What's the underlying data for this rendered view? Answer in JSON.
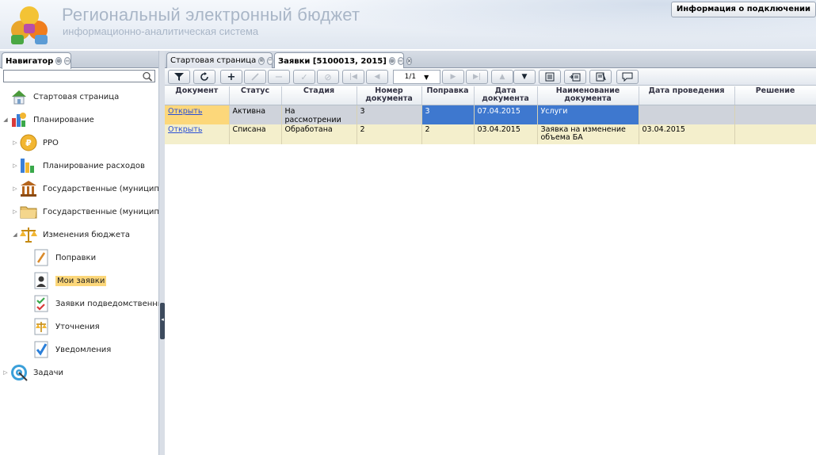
{
  "header": {
    "title": "Региональный электронный бюджет",
    "subtitle": "информационно-аналитическая система",
    "info_button": "Информация о подключении"
  },
  "navigator": {
    "tab_label": "Навигатор",
    "search_placeholder": "",
    "items": [
      {
        "label": "Стартовая страница",
        "icon": "home-icon",
        "level": 0
      },
      {
        "label": "Планирование",
        "icon": "planning-icon",
        "level": 0,
        "expanded": true
      },
      {
        "label": "РРО",
        "icon": "coin-icon",
        "level": 1
      },
      {
        "label": "Планирование расходов",
        "icon": "bar-chart-icon",
        "level": 1
      },
      {
        "label": "Государственные (муниципаль",
        "icon": "institution-icon",
        "level": 1
      },
      {
        "label": "Государственные (муниципаль",
        "icon": "folder-icon",
        "level": 1
      },
      {
        "label": "Изменения бюджета",
        "icon": "scales-icon",
        "level": 1,
        "expanded": true
      },
      {
        "label": "Поправки",
        "icon": "pencil-document-icon",
        "level": 2
      },
      {
        "label": "Мои заявки",
        "icon": "user-document-icon",
        "level": 2,
        "selected": true
      },
      {
        "label": "Заявки подведомственных",
        "icon": "check-list-icon",
        "level": 2
      },
      {
        "label": "Уточнения",
        "icon": "scales-document-icon",
        "level": 2
      },
      {
        "label": "Уведомления",
        "icon": "checkmark-document-icon",
        "level": 2
      },
      {
        "label": "Задачи",
        "icon": "target-icon",
        "level": 0
      }
    ]
  },
  "tabs": [
    {
      "label": "Стартовая страница",
      "active": false
    },
    {
      "label": "Заявки [5100013, 2015]",
      "active": true
    }
  ],
  "toolbar": {
    "pager": "1/1",
    "buttons": [
      "filter-icon",
      "refresh-icon",
      "add-icon",
      "edit-icon",
      "delete-icon",
      "approve-icon",
      "cancel-icon",
      "first-page-icon",
      "prev-page-icon",
      "next-page-icon",
      "last-page-icon",
      "move-up-icon",
      "move-down-icon",
      "list-icon",
      "export-icon",
      "print-icon",
      "comment-icon"
    ]
  },
  "grid": {
    "columns": [
      "Документ",
      "Статус",
      "Стадия",
      "Номер документа",
      "Поправка",
      "Дата документа",
      "Наименование документа",
      "Дата проведения",
      "Решение"
    ],
    "rows": [
      {
        "doc": "Открыть",
        "status": "Активна",
        "stage": "На рассмотрении",
        "number": "3",
        "amendment": "3",
        "date": "07.04.2015",
        "name": "Услуги",
        "held": "",
        "decision": ""
      },
      {
        "doc": "Открыть",
        "status": "Списана",
        "stage": "Обработана",
        "number": "2",
        "amendment": "2",
        "date": "03.04.2015",
        "name": "Заявка на изменение объема БА",
        "held": "03.04.2015",
        "decision": ""
      }
    ]
  },
  "colors": {
    "selection": "#fcd77a",
    "row_highlight_blue": "#3e78cf",
    "row_alt": "#f4efcc",
    "link": "#2a4fd6"
  }
}
